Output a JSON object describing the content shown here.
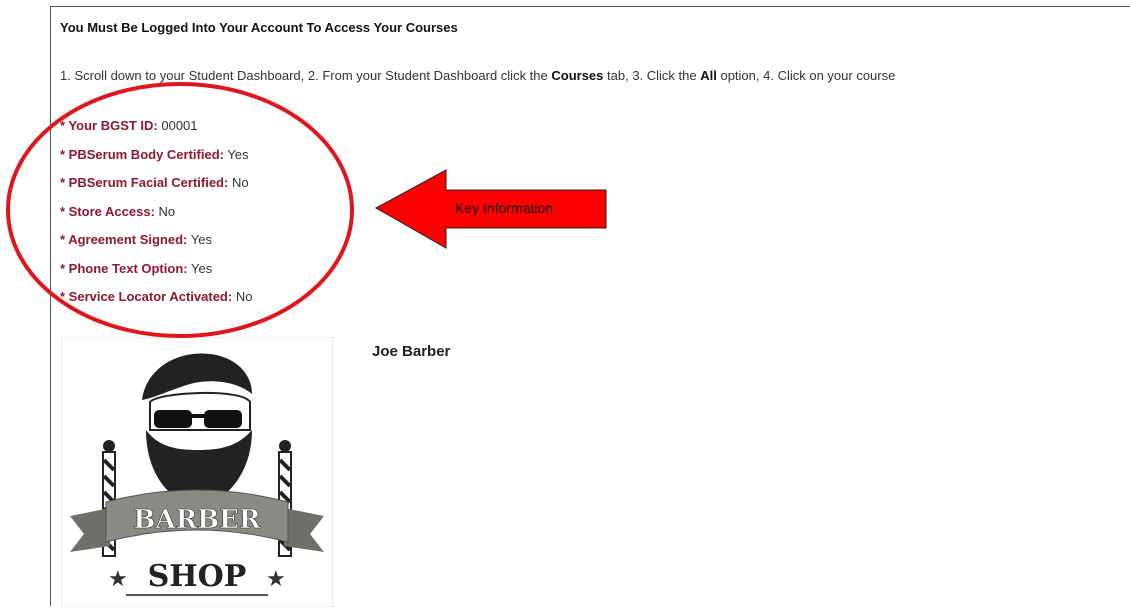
{
  "header": {
    "title": "You Must Be Logged Into Your Account To Access Your Courses"
  },
  "instructions": {
    "p1": "1. Scroll down to your Student Dashboard, 2. From your Student Dashboard click the ",
    "b1": "Courses",
    "p2": " tab, 3. Click the ",
    "b2": "All",
    "p3": " option, 4. Click on your course"
  },
  "account_info": [
    {
      "label": "* Your BGST ID:",
      "value": " 00001"
    },
    {
      "label": "* PBSerum Body Certified:",
      "value": " Yes"
    },
    {
      "label": "* PBSerum Facial Certified:",
      "value": " No"
    },
    {
      "label": "* Store Access:",
      "value": " No"
    },
    {
      "label": "* Agreement Signed:",
      "value": " Yes"
    },
    {
      "label": "* Phone Text Option:",
      "value": " Yes"
    },
    {
      "label": "* Service Locator Activated:",
      "value": " No"
    }
  ],
  "annotation": {
    "arrow_label": "Key Information",
    "circle_color": "#e0161e",
    "arrow_color": "#ff0000"
  },
  "profile": {
    "name": "Joe Barber",
    "logo": {
      "icon": "barber-shop-logo",
      "banner_text": "BARBER",
      "shop_text": "SHOP",
      "star": "★"
    }
  }
}
